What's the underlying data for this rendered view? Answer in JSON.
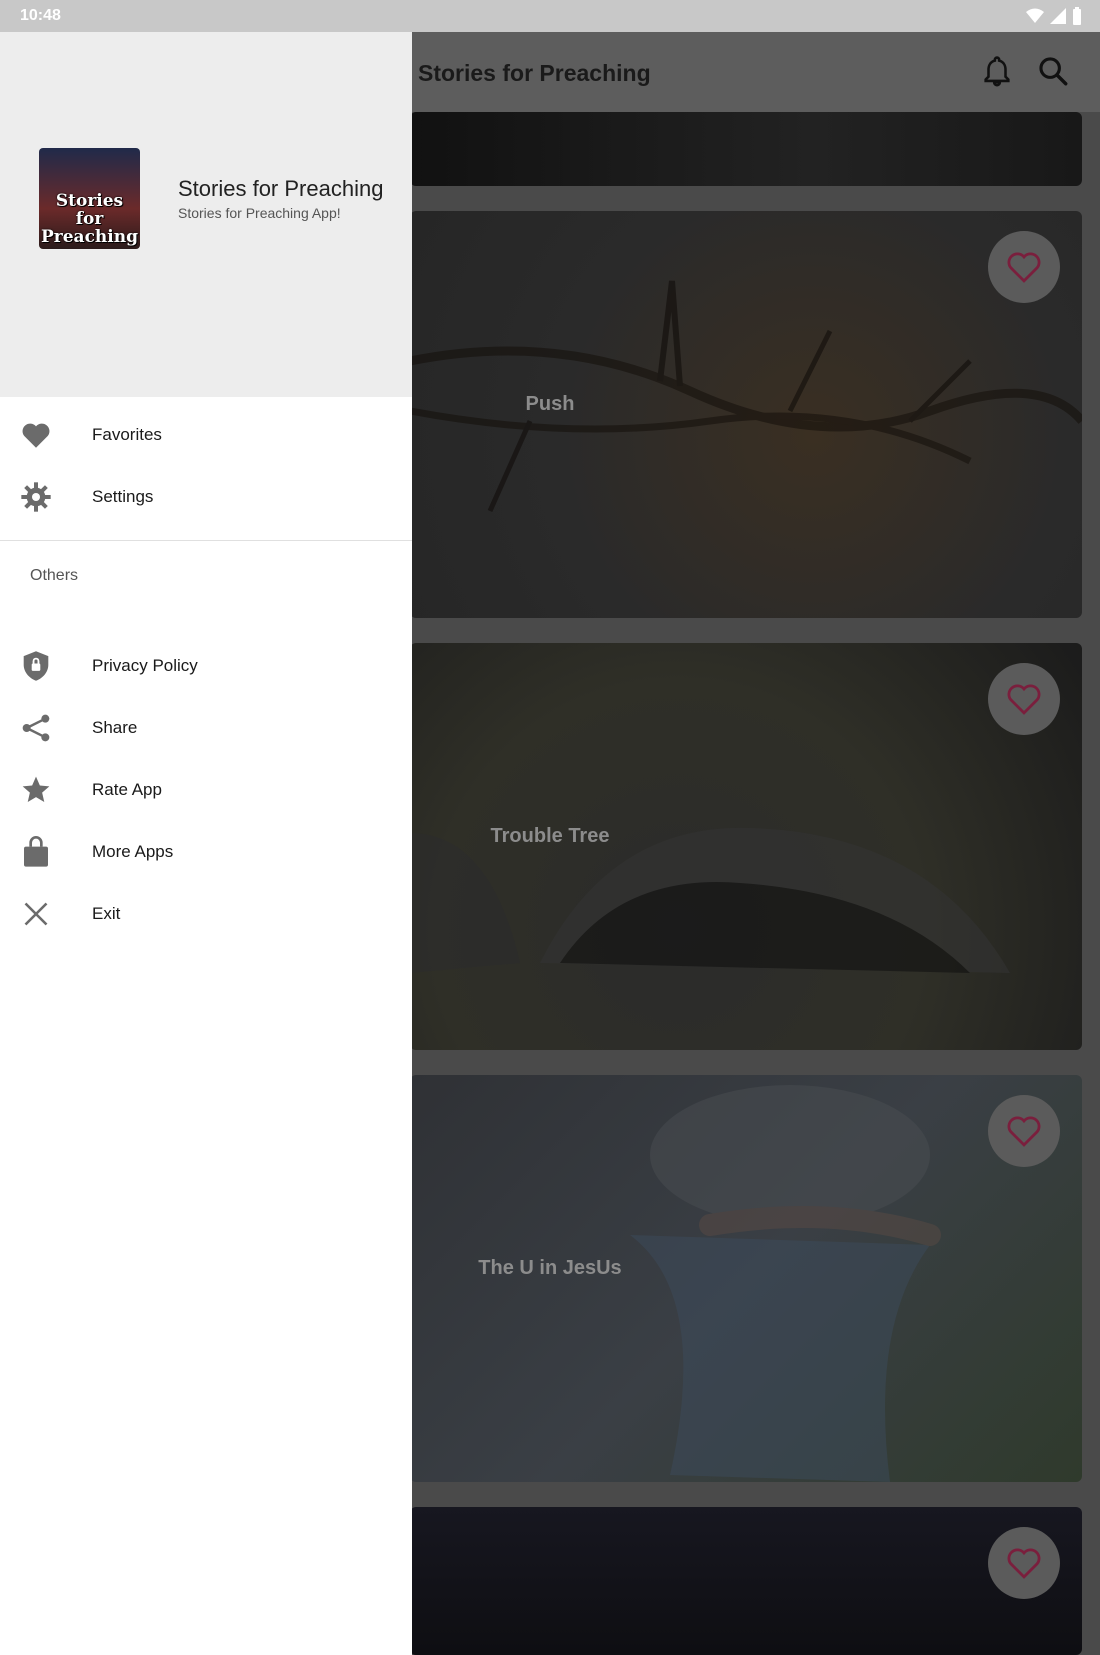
{
  "status_bar": {
    "time": "10:48"
  },
  "toolbar": {
    "title": "Stories for Preaching"
  },
  "cards": [
    {
      "label": ""
    },
    {
      "label": "Push"
    },
    {
      "label": "Trouble Tree"
    },
    {
      "label": "The U in JesUs"
    },
    {
      "label": ""
    }
  ],
  "drawer": {
    "logo_text": "Stories for Preaching",
    "title": "Stories for Preaching",
    "subtitle": "Stories for Preaching App!",
    "primary_items": [
      {
        "label": "Favorites",
        "icon": "heart-icon"
      },
      {
        "label": "Settings",
        "icon": "gear-icon"
      }
    ],
    "section_label": "Others",
    "other_items": [
      {
        "label": "Privacy Policy",
        "icon": "shield-lock-icon"
      },
      {
        "label": "Share",
        "icon": "share-icon"
      },
      {
        "label": "Rate App",
        "icon": "star-icon"
      },
      {
        "label": "More Apps",
        "icon": "shopping-bag-icon"
      },
      {
        "label": "Exit",
        "icon": "close-icon"
      }
    ]
  },
  "colors": {
    "accent": "#c2185b",
    "drawer_header": "#ededed",
    "icon_gray": "#6b6b6b"
  }
}
